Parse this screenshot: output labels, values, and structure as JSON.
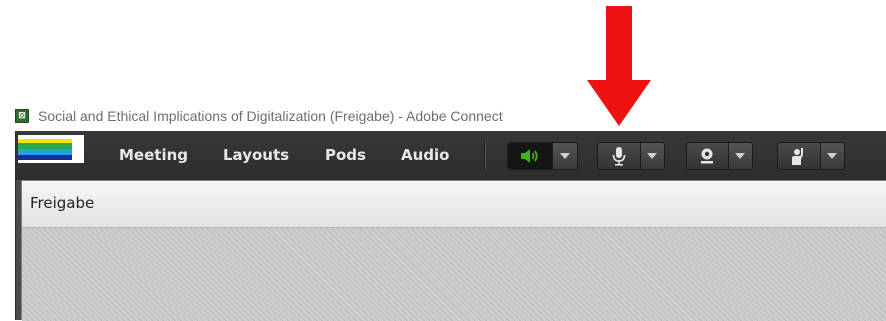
{
  "window": {
    "title": "Social and Ethical Implications of Digitalization (Freigabe) - Adobe Connect"
  },
  "menu": {
    "items": [
      {
        "label": "Meeting"
      },
      {
        "label": "Layouts"
      },
      {
        "label": "Pods"
      },
      {
        "label": "Audio"
      }
    ]
  },
  "toolbar": {
    "buttons": [
      {
        "icon": "speaker-icon",
        "active": true,
        "color": "#3fb618"
      },
      {
        "icon": "microphone-icon",
        "active": false
      },
      {
        "icon": "webcam-icon",
        "active": false
      },
      {
        "icon": "raise-hand-icon",
        "active": false
      }
    ]
  },
  "pod": {
    "title": "Freigabe"
  },
  "annotation": {
    "arrow_color": "#ee1111",
    "icon": "red-arrow-icon"
  },
  "colors": {
    "menubar": "#333333",
    "pod_header": "#ececec",
    "accent_green": "#3fb618"
  }
}
